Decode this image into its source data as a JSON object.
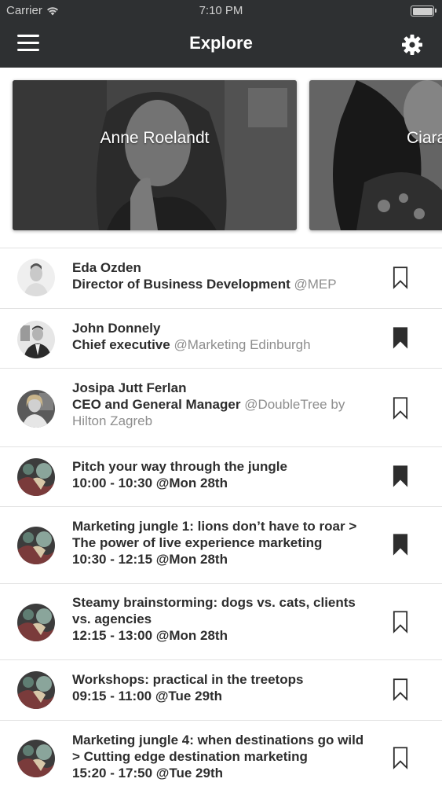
{
  "status_bar": {
    "carrier": "Carrier",
    "time": "7:10 PM"
  },
  "nav": {
    "title": "Explore",
    "menu_icon": "hamburger-menu-icon",
    "settings_icon": "gear-icon"
  },
  "featured_speakers": [
    {
      "name": "Anne Roelandt"
    },
    {
      "name": "Ciara"
    }
  ],
  "items": [
    {
      "title": "Eda Ozden",
      "role": "Director of Business Development",
      "org": "@MEP",
      "bookmarked": false
    },
    {
      "title": "John Donnely",
      "role": "Chief executive",
      "org": "@Marketing Edinburgh",
      "bookmarked": true
    },
    {
      "title": "Josipa Jutt Ferlan",
      "role": "CEO and General Manager",
      "org": "@DoubleTree by Hilton Zagreb",
      "bookmarked": false
    },
    {
      "title": "Pitch your way through the jungle",
      "time": "10:00 - 10:30 @Mon 28th",
      "bookmarked": true
    },
    {
      "title": "Marketing jungle 1: lions don’t have to roar > The power of live experience marketing",
      "time": "10:30 - 12:15 @Mon 28th",
      "bookmarked": true
    },
    {
      "title": "Steamy brainstorming: dogs vs. cats, clients vs. agencies",
      "time": "12:15 - 13:00 @Mon 28th",
      "bookmarked": false
    },
    {
      "title": "Workshops: practical in the treetops",
      "time": "09:15 - 11:00 @Tue 29th",
      "bookmarked": false
    },
    {
      "title": "Marketing jungle 4: when destinations go wild > Cutting edge destination marketing",
      "time": "15:20 - 17:50 @Tue 29th",
      "bookmarked": false
    }
  ],
  "colors": {
    "nav_bg": "#2e3032",
    "text": "#2d2d2d",
    "muted": "#8e8e8e"
  }
}
